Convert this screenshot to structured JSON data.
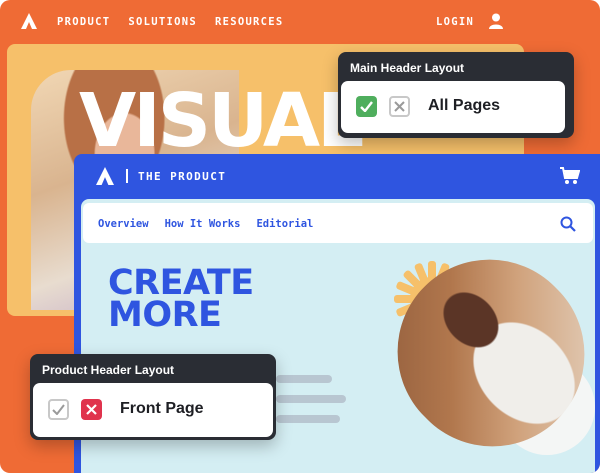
{
  "topnav": {
    "links": [
      "PRODUCT",
      "SOLUTIONS",
      "RESOURCES"
    ],
    "login": "LOGIN"
  },
  "hero": {
    "big_text": "VISUAL"
  },
  "main_header_popover": {
    "title": "Main Header Layout",
    "option_label": "All Pages",
    "checked": true
  },
  "product_window": {
    "title": "THE PRODUCT",
    "nav_links": [
      "Overview",
      "How It Works",
      "Editorial"
    ],
    "headline_line1": "CREATE",
    "headline_line2": "MORE"
  },
  "product_header_popover": {
    "title": "Product Header Layout",
    "option_label": "Front Page",
    "checked": false
  },
  "colors": {
    "page_bg": "#ef6b35",
    "back_card": "#f6c06a",
    "front_card": "#2f55e0",
    "inner_bg": "#d4eef3",
    "popover_dark": "#2a2d34",
    "check_green": "#4fae5d",
    "x_red": "#e0334d"
  },
  "icons": [
    "logo-icon",
    "user-icon",
    "cart-icon",
    "search-icon",
    "check-icon",
    "x-icon",
    "sun-shape"
  ]
}
